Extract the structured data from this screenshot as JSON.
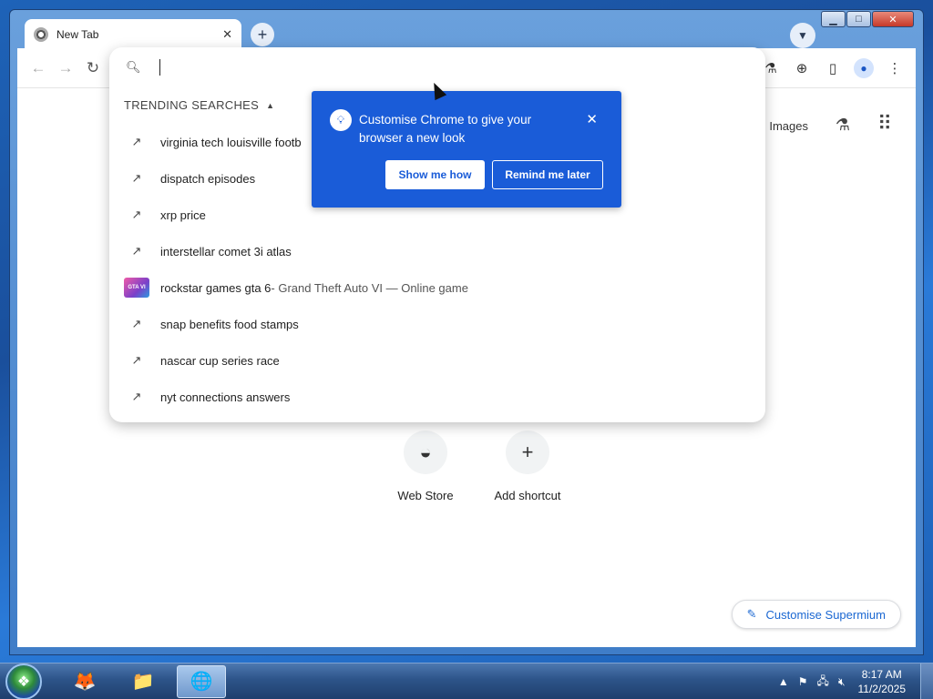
{
  "window": {
    "tab_title": "New Tab",
    "new_tab_symbol": "+",
    "controls": {
      "minimize": "▁",
      "maximize": "□",
      "close": "✕"
    }
  },
  "toolbar": {
    "icons": [
      "back-icon",
      "forward-icon",
      "reload-icon",
      "labs-icon",
      "download-icon",
      "side-panel-icon",
      "profile-icon",
      "menu-icon"
    ]
  },
  "omnibox": {
    "value": "",
    "trending_header": "TRENDING SEARCHES",
    "suggestions": [
      {
        "text": "virginia tech louisville footb",
        "icon": "trending-icon"
      },
      {
        "text": "dispatch episodes",
        "icon": "trending-icon"
      },
      {
        "text": "xrp price",
        "icon": "trending-icon"
      },
      {
        "text": "interstellar comet 3i atlas",
        "icon": "trending-icon"
      },
      {
        "text": "rockstar games gta 6",
        "detail": " - Grand Theft Auto VI — Online game",
        "icon": "gta6-thumbnail"
      },
      {
        "text": "snap benefits food stamps",
        "icon": "trending-icon"
      },
      {
        "text": "nascar cup series race",
        "icon": "trending-icon"
      },
      {
        "text": "nyt connections answers",
        "icon": "trending-icon"
      }
    ]
  },
  "promo": {
    "text": "Customise Chrome to give your browser a new look",
    "primary_button": "Show me how",
    "secondary_button": "Remind me later"
  },
  "ntp": {
    "images_link": "Images",
    "shortcuts": [
      {
        "label": "Web Store",
        "icon": "web-store-icon"
      },
      {
        "label": "Add shortcut",
        "icon": "plus-icon"
      }
    ],
    "customise_button": "Customise Supermium"
  },
  "taskbar": {
    "apps": [
      "start-orb",
      "media-app-icon",
      "file-explorer-icon",
      "browser-icon"
    ],
    "clock_time": "8:17 AM",
    "clock_date": "11/2/2025"
  }
}
